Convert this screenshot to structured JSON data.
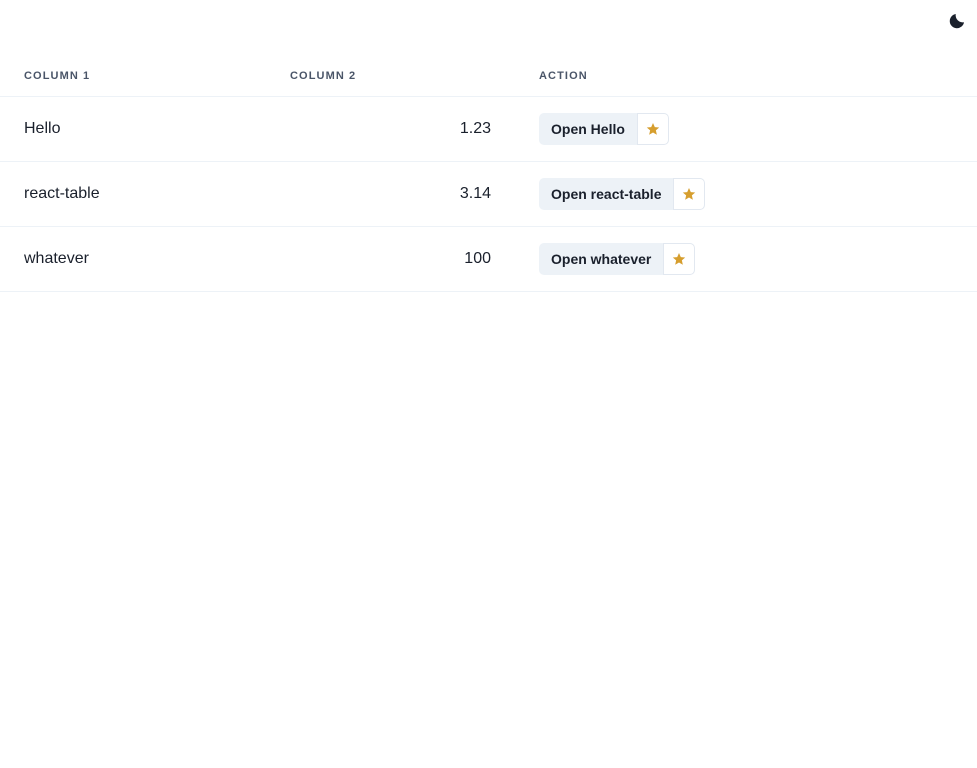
{
  "header": {
    "theme_toggle_icon": "moon-icon"
  },
  "table": {
    "columns": [
      "Column 1",
      "Column 2",
      "Action"
    ],
    "rows": [
      {
        "col1": "Hello",
        "col2": "1.23",
        "action": "Open Hello"
      },
      {
        "col1": "react-table",
        "col2": "3.14",
        "action": "Open react-table"
      },
      {
        "col1": "whatever",
        "col2": "100",
        "action": "Open whatever"
      }
    ],
    "star_icon": "star-icon"
  },
  "colors": {
    "star": "#d69e2e",
    "moon": "#1a202c",
    "button_bg": "#edf2f7"
  }
}
